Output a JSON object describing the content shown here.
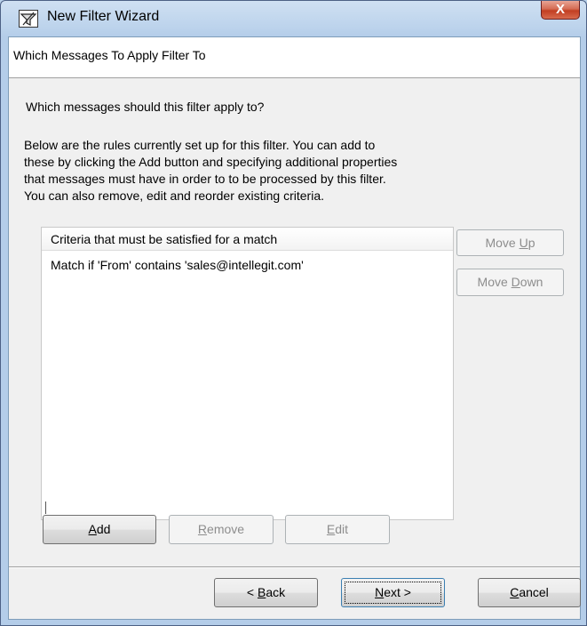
{
  "window": {
    "title": "New Filter Wizard",
    "close_glyph": "X"
  },
  "header": {
    "title": "Which Messages To Apply Filter To"
  },
  "question": "Which messages should this filter apply to?",
  "description": [
    "Below are the rules currently set up for this filter.  You can add to",
    "these by clicking the Add button and specifying additional properties",
    "that messages must have in order to to be processed by this filter.",
    "You can also remove, edit and reorder existing criteria."
  ],
  "criteria_list": {
    "column_header": "Criteria that must be satisfied for a match",
    "items": [
      "Match if 'From' contains 'sales@intellegit.com'"
    ]
  },
  "side_buttons": {
    "move_up": {
      "pre": "Move ",
      "key": "U",
      "post": "p"
    },
    "move_down": {
      "pre": "Move ",
      "key": "D",
      "post": "own"
    }
  },
  "edit_buttons": {
    "add": {
      "key": "A",
      "post": "dd"
    },
    "remove": {
      "key": "R",
      "post": "emove"
    },
    "edit": {
      "key": "E",
      "post": "dit"
    }
  },
  "nav_buttons": {
    "back": {
      "pre": "< ",
      "key": "B",
      "post": "ack"
    },
    "next": {
      "key": "N",
      "post": "ext >"
    },
    "cancel": {
      "key": "C",
      "post": "ancel"
    }
  },
  "icons": {
    "app": "filter-wizard-icon",
    "close": "close-icon"
  }
}
